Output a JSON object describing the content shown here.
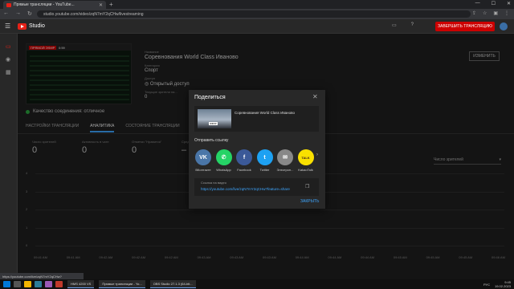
{
  "browser": {
    "tab_title": "Прямые трансляции - YouTube...",
    "url": "studio.youtube.com/video/zqN7mY2qCHw/livestreaming",
    "status_url": "https://youtube.com/live/zqN7mY2qCHw?feature=share"
  },
  "header": {
    "studio_label": "Studio",
    "end_stream_label": "ЗАВЕРШИТЬ ТРАНСЛЯЦИЮ"
  },
  "stream": {
    "live_badge": "ПРЯМОЙ ЭФИР",
    "elapsed": "0:59",
    "title_label": "Название",
    "title": "Соревнования World Class Иваново",
    "category_label": "Категория",
    "category": "Спорт",
    "privacy_label": "Доступ",
    "privacy": "Открытый доступ",
    "viewers_label": "Текущие зрители на...",
    "viewers_value": "0",
    "edit_label": "ИЗМЕНИТЬ",
    "quality": "Качество соединения: отличное"
  },
  "tabs": [
    "НАСТРОЙКИ ТРАНСЛЯЦИИ",
    "АНАЛИТИКА",
    "СОСТОЯНИЕ ТРАНСЛЯЦИИ"
  ],
  "stats": [
    {
      "label": "Число зрителей",
      "value": "0"
    },
    {
      "label": "Активность в чате",
      "value": "0"
    },
    {
      "label": "Отметки \"Нравится\"",
      "value": "0"
    },
    {
      "label": "Средн...",
      "value": "–"
    }
  ],
  "chart": {
    "selector": "Число зрителей",
    "y_ticks": [
      "4",
      "3",
      "2",
      "1",
      "0"
    ],
    "x_ticks": [
      "09:41 AM",
      "09:41 AM",
      "09:42 AM",
      "09:42 AM",
      "09:42 AM",
      "09:43 AM",
      "09:43 AM",
      "09:43 AM",
      "09:44 AM",
      "09:44 AM",
      "09:44 AM",
      "09:45 AM",
      "09:45 AM",
      "09:45 AM",
      "09:46 AM"
    ]
  },
  "share": {
    "title": "Поделиться",
    "video_title": "Соревнования World Class Иваново",
    "thumb_badge": "ЭФИР",
    "send_label": "Отправить ссылку",
    "targets": [
      {
        "label": "ВКонтакте",
        "glyph": "VK",
        "color": "#4a76a8"
      },
      {
        "label": "WhatsApp",
        "glyph": "✆",
        "color": "#25d366"
      },
      {
        "label": "Facebook",
        "glyph": "f",
        "color": "#3b5998"
      },
      {
        "label": "Twitter",
        "glyph": "t",
        "color": "#1da1f2"
      },
      {
        "label": "Электрон...",
        "glyph": "✉",
        "color": "#888888"
      },
      {
        "label": "KakaoTalk",
        "glyph": "TALK",
        "color": "#f9e000"
      }
    ],
    "link_label": "Ссылка на видео",
    "link_url": "https://youtube.com/live/zqN7mY2qCHw?feature=share",
    "close_label": "ЗАКРЫТЬ"
  },
  "taskbar": {
    "apps": [
      "HMS 4200 VS",
      "Прямые трансляции - Yo...",
      "OBS Studio 27.1.3 (64-bit..."
    ],
    "lang": "РУС",
    "time": "9:45",
    "date": "19.02.2023"
  }
}
